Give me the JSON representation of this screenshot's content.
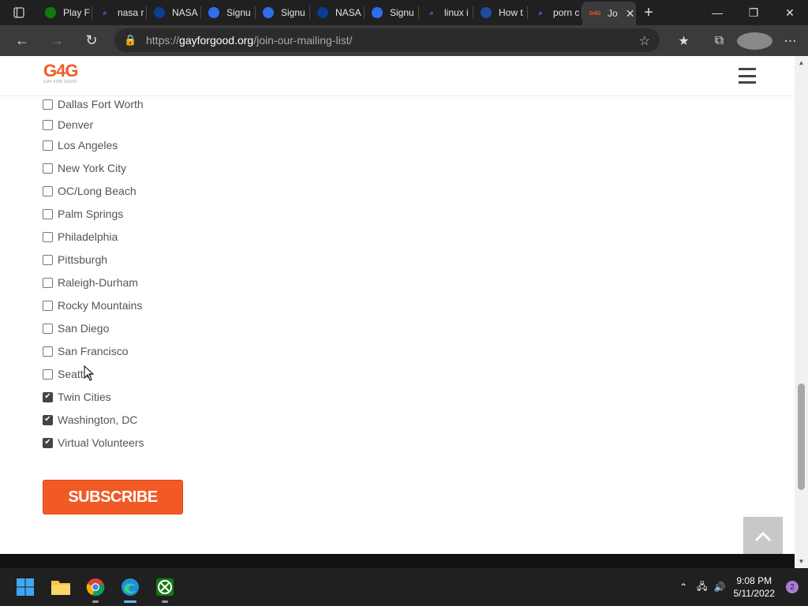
{
  "browser": {
    "tabs": [
      {
        "title": "Play F",
        "favicon": "xbox-icon",
        "color": "#107c10"
      },
      {
        "title": "nasa r",
        "favicon": "search-icon",
        "color": "#3b8ded"
      },
      {
        "title": "NASA",
        "favicon": "nasa-icon",
        "color": "#0b3d91"
      },
      {
        "title": "Signu",
        "favicon": "firefox-account-icon",
        "color": "#2f6feb"
      },
      {
        "title": "Signu",
        "favicon": "firefox-account-icon",
        "color": "#2f6feb"
      },
      {
        "title": "NASA",
        "favicon": "nasa-icon",
        "color": "#0b3d91"
      },
      {
        "title": "Signu",
        "favicon": "firefox-account-icon",
        "color": "#2f6feb"
      },
      {
        "title": "linux i",
        "favicon": "search-icon",
        "color": "#3b8ded"
      },
      {
        "title": "How t",
        "favicon": "l-icon",
        "color": "#1e4ca1"
      },
      {
        "title": "porn c",
        "favicon": "search-icon",
        "color": "#3b8ded"
      },
      {
        "title": "Jo",
        "favicon": "g4g-icon",
        "color": "#f15a24",
        "active": true
      }
    ],
    "url": {
      "scheme": "https://",
      "host": "gayforgood.org",
      "path": "/join-our-mailing-list/"
    }
  },
  "site": {
    "logo_text": "G4G",
    "logo_sub": "GAY FOR GOOD",
    "brand_color": "#f15a24"
  },
  "form": {
    "options": [
      {
        "label": "Dallas Fort Worth",
        "checked": false
      },
      {
        "label": "Denver",
        "checked": false
      },
      {
        "label": "Los Angeles",
        "checked": false
      },
      {
        "label": "New York City",
        "checked": false
      },
      {
        "label": "OC/Long Beach",
        "checked": false
      },
      {
        "label": "Palm Springs",
        "checked": false
      },
      {
        "label": "Philadelphia",
        "checked": false
      },
      {
        "label": "Pittsburgh",
        "checked": false
      },
      {
        "label": "Raleigh-Durham",
        "checked": false
      },
      {
        "label": "Rocky Mountains",
        "checked": false
      },
      {
        "label": "San Diego",
        "checked": false
      },
      {
        "label": "San Francisco",
        "checked": false
      },
      {
        "label": "Seattle",
        "checked": false
      },
      {
        "label": "Twin Cities",
        "checked": true
      },
      {
        "label": "Washington, DC",
        "checked": true
      },
      {
        "label": "Virtual Volunteers",
        "checked": true
      }
    ],
    "subscribe_label": "SUBSCRIBE"
  },
  "taskbar": {
    "time": "9:08 PM",
    "date": "5/11/2022",
    "notifications": "2"
  }
}
